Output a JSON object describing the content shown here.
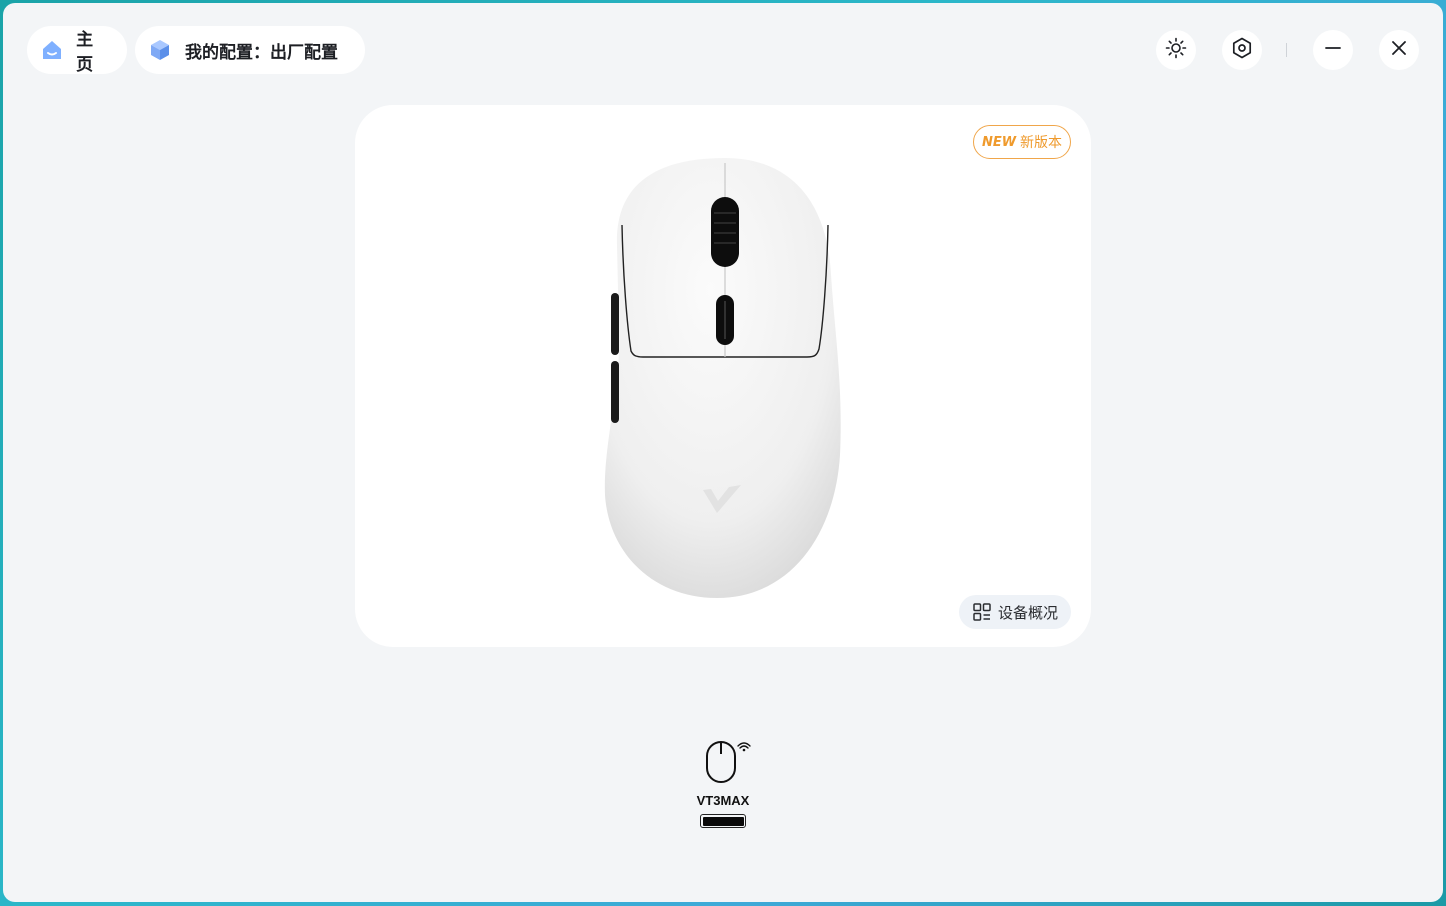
{
  "nav": {
    "home_label": "主页",
    "config_label": "我的配置：出厂配置"
  },
  "window_controls": {
    "icons": [
      "brightness-icon",
      "settings-icon",
      "minimize-icon",
      "close-icon"
    ]
  },
  "device_card": {
    "new_badge_prefix": "NEW",
    "new_badge_text": "新版本",
    "overview_label": "设备概况"
  },
  "device": {
    "name": "VT3MAX",
    "battery_level": 1.0,
    "connection": "wireless"
  },
  "colors": {
    "accent_orange": "#ef9a2c",
    "home_icon_blue": "#6ea6ff",
    "window_bg": "#f3f5f7"
  }
}
